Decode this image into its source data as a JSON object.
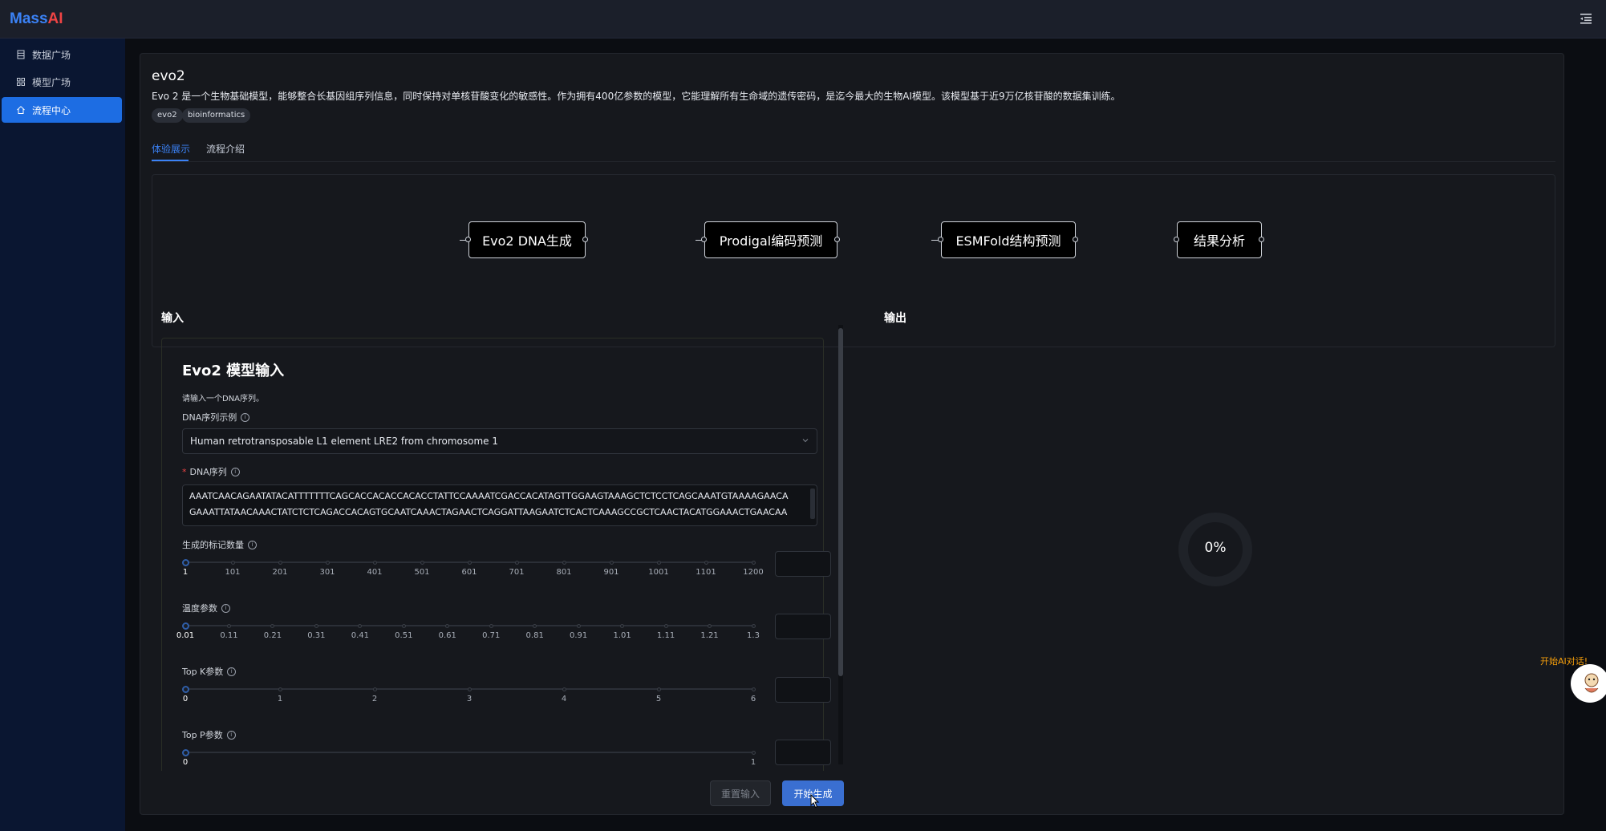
{
  "app": {
    "logo_part1": "Mass",
    "logo_part2": "AI"
  },
  "sidebar": {
    "items": [
      {
        "label": "数据广场",
        "icon": "database-icon",
        "active": false
      },
      {
        "label": "模型广场",
        "icon": "grid-icon",
        "active": false
      },
      {
        "label": "流程中心",
        "icon": "home-icon",
        "active": true
      }
    ]
  },
  "page": {
    "title": "evo2",
    "description": "Evo 2 是一个生物基础模型，能够整合长基因组序列信息，同时保持对单核苷酸变化的敏感性。作为拥有400亿参数的模型，它能理解所有生命域的遗传密码，是迄今最大的生物AI模型。该模型基于近9万亿核苷酸的数据集训练。",
    "tags": [
      "evo2",
      "bioinformatics"
    ],
    "tabs": [
      {
        "label": "体验展示",
        "active": true
      },
      {
        "label": "流程介绍",
        "active": false
      }
    ]
  },
  "flow": {
    "nodes": [
      "Evo2 DNA生成",
      "Prodigal编码预测",
      "ESMFold结构预测",
      "结果分析"
    ]
  },
  "input": {
    "section_title": "输入",
    "form_title": "Evo2 模型输入",
    "hint": "请输入一个DNA序列。",
    "example_label": "DNA序列示例",
    "example_value": "Human retrotransposable L1 element LRE2 from chromosome 1",
    "dna_label": "DNA序列",
    "dna_lines": [
      "AAATCAACAGAATATACATTTTTTTCAGCACCACACCACACCTATTCCAAAATCGACCACATAGTTGGAAGTAAAGCTCTCCTCAGCAAATGTAAAAGAACA",
      "GAAATTATAACAAACTATCTCTCAGACCACAGTGCAATCAAACTAGAACTCAGGATTAAGAATCTCACTCAAAGCCGCTCAACTACATGGAAACTGAACAA"
    ],
    "sliders": [
      {
        "label": "生成的标记数量",
        "ticks": [
          "1",
          "101",
          "201",
          "301",
          "401",
          "501",
          "601",
          "701",
          "801",
          "901",
          "1001",
          "1101",
          "1200"
        ],
        "value": 1
      },
      {
        "label": "温度参数",
        "ticks": [
          "0.01",
          "0.11",
          "0.21",
          "0.31",
          "0.41",
          "0.51",
          "0.61",
          "0.71",
          "0.81",
          "0.91",
          "1.01",
          "1.11",
          "1.21",
          "1.3"
        ],
        "value": 0.01
      },
      {
        "label": "Top K参数",
        "ticks": [
          "0",
          "1",
          "2",
          "3",
          "4",
          "5",
          "6"
        ],
        "value": 0
      },
      {
        "label": "Top P参数",
        "ticks": [
          "0",
          "1"
        ],
        "value": 0
      }
    ]
  },
  "output": {
    "section_title": "输出",
    "progress_text": "0%",
    "progress_value": 0
  },
  "actions": {
    "reset_label": "重置输入",
    "start_label": "开始生成"
  },
  "assistant": {
    "label": "开始AI对话!"
  },
  "colors": {
    "accent": "#1d6de3",
    "sidebar_bg": "#0a1631",
    "primary_button": "#3a6fd1",
    "assistant_text": "#f59e0b"
  }
}
